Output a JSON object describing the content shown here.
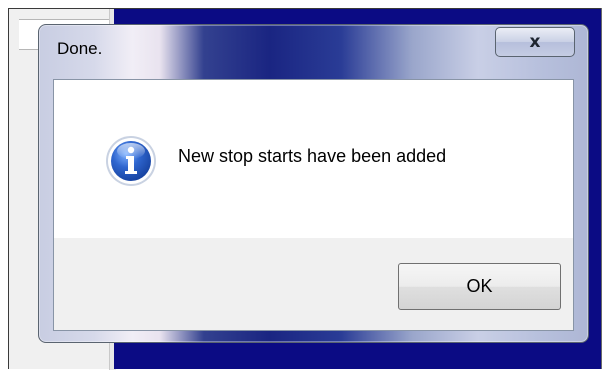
{
  "dialog": {
    "title": "Done.",
    "close_label": "x",
    "message": "New stop starts have been added",
    "icon": "info-icon",
    "ok_label": "OK"
  },
  "colors": {
    "desktop_background": "#0b0b84",
    "title_bar_accent": "#1a2582",
    "button_area": "#f0f0f0"
  }
}
